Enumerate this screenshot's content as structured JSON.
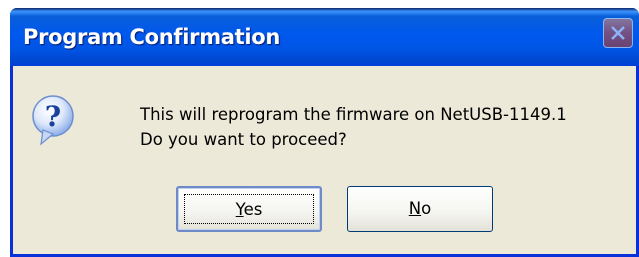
{
  "window": {
    "title": "Program Confirmation"
  },
  "message": {
    "line1": "This will reprogram the firmware on NetUSB-1149.1",
    "line2": "Do you want to proceed?"
  },
  "buttons": {
    "yes_mnemonic": "Y",
    "yes_rest": "es",
    "no_mnemonic": "N",
    "no_rest": "o"
  },
  "icons": {
    "dialog": "question-icon",
    "close": "close-icon"
  },
  "colors": {
    "titlebar": "#0058ee",
    "client": "#ece9d8",
    "close_button": "#d24a2c"
  }
}
